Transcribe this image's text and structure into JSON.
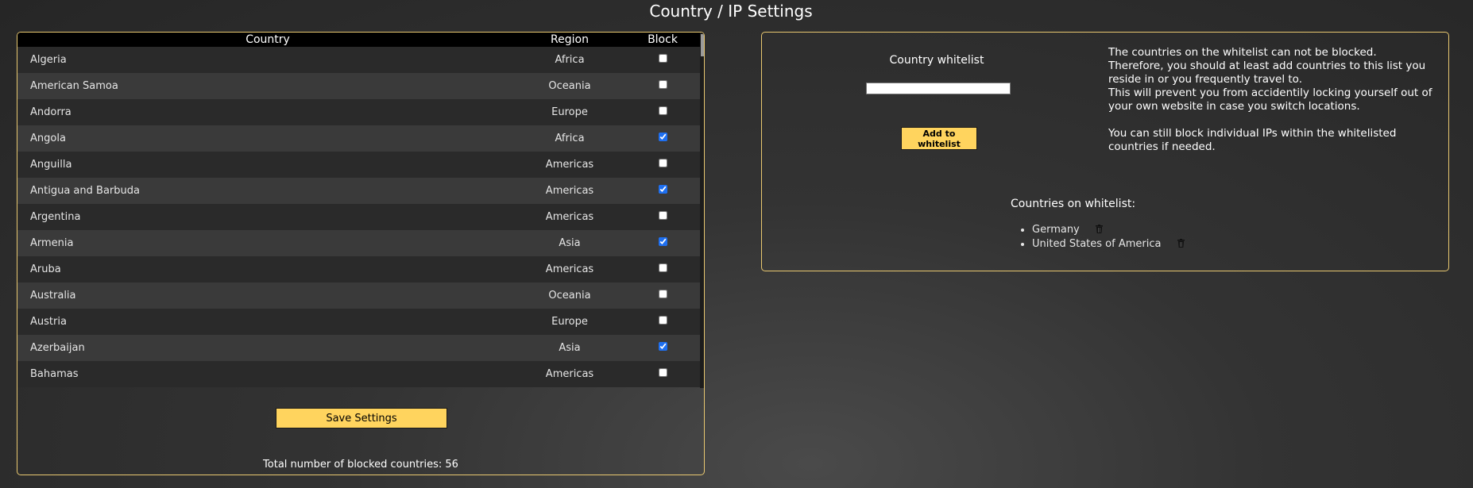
{
  "page": {
    "title": "Country / IP Settings"
  },
  "countries_table": {
    "headers": {
      "country": "Country",
      "region": "Region",
      "block": "Block"
    },
    "rows": [
      {
        "country": "Algeria",
        "region": "Africa",
        "blocked": false
      },
      {
        "country": "American Samoa",
        "region": "Oceania",
        "blocked": false
      },
      {
        "country": "Andorra",
        "region": "Europe",
        "blocked": false
      },
      {
        "country": "Angola",
        "region": "Africa",
        "blocked": true
      },
      {
        "country": "Anguilla",
        "region": "Americas",
        "blocked": false
      },
      {
        "country": "Antigua and Barbuda",
        "region": "Americas",
        "blocked": true
      },
      {
        "country": "Argentina",
        "region": "Americas",
        "blocked": false
      },
      {
        "country": "Armenia",
        "region": "Asia",
        "blocked": true
      },
      {
        "country": "Aruba",
        "region": "Americas",
        "blocked": false
      },
      {
        "country": "Australia",
        "region": "Oceania",
        "blocked": false
      },
      {
        "country": "Austria",
        "region": "Europe",
        "blocked": false
      },
      {
        "country": "Azerbaijan",
        "region": "Asia",
        "blocked": true
      },
      {
        "country": "Bahamas",
        "region": "Americas",
        "blocked": false
      }
    ]
  },
  "actions": {
    "save_label": "Save Settings"
  },
  "summary": {
    "total_blocked": "Total number of blocked countries: 56"
  },
  "whitelist": {
    "label": "Country whitelist",
    "input_value": "",
    "add_label": "Add to whitelist",
    "info": {
      "line1": "The countries on the whitelist can not be blocked.",
      "line2": "Therefore, you should at least add countries to this list you reside in or you frequently travel to.",
      "line3": "This will prevent you from accidentily locking yourself out of your own website in case you switch locations.",
      "line4": "You can still block individual IPs within the whitelisted countries if needed."
    },
    "list_title": "Countries on whitelist:",
    "items": [
      {
        "name": "Germany",
        "icon": "trash-icon"
      },
      {
        "name": "United States of America",
        "icon": "trash-icon"
      }
    ]
  },
  "colors": {
    "accent": "#ffd45e",
    "panel_border": "#e9c870",
    "checkbox": "#1e6ff0"
  }
}
